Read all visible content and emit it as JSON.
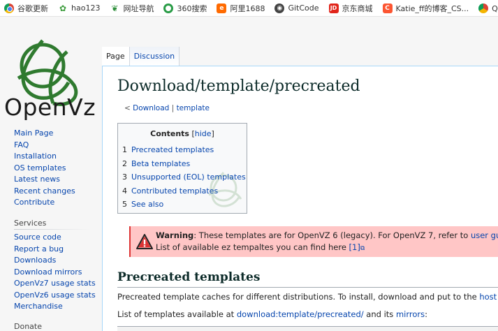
{
  "bookmarks": [
    {
      "label": "谷歌更新",
      "icon": "chrome-icon"
    },
    {
      "label": "hao123",
      "icon": "hao123-icon"
    },
    {
      "label": "网址导航",
      "icon": "nav-icon"
    },
    {
      "label": "360搜索",
      "icon": "360-search-icon"
    },
    {
      "label": "阿里1688",
      "icon": "alibaba-icon"
    },
    {
      "label": "GitCode",
      "icon": "gitcode-icon"
    },
    {
      "label": "京东商城",
      "icon": "jd-icon"
    },
    {
      "label": "Katie_ff的博客_CS...",
      "icon": "csdn-icon"
    },
    {
      "label": "QQ邮箱",
      "icon": "qq-mail-icon"
    }
  ],
  "logo_text": "OpenVz",
  "sidebar": {
    "nav": [
      "Main Page",
      "FAQ",
      "Installation",
      "OS templates",
      "Latest news",
      "Recent changes",
      "Contribute"
    ],
    "services_heading": "Services",
    "services": [
      "Source code",
      "Report a bug",
      "Downloads",
      "Download mirrors",
      "OpenVz7 usage stats",
      "OpenVz6 usage stats",
      "Merchandise"
    ],
    "donate_heading": "Donate"
  },
  "tabs": {
    "page": "Page",
    "discussion": "Discussion"
  },
  "page": {
    "title": "Download/template/precreated",
    "subpages_prefix": "< ",
    "subpage_download": "Download",
    "subpage_sep": " | ",
    "subpage_template": "template"
  },
  "toc": {
    "title": "Contents",
    "hide_open": " [",
    "hide": "hide",
    "hide_close": "]",
    "items": [
      {
        "num": "1",
        "label": "Precreated templates"
      },
      {
        "num": "2",
        "label": "Beta templates"
      },
      {
        "num": "3",
        "label": "Unsupported (EOL) templates"
      },
      {
        "num": "4",
        "label": "Contributed templates"
      },
      {
        "num": "5",
        "label": "See also"
      }
    ]
  },
  "warning": {
    "strong": "Warning",
    "text": ": These templates are for OpenVZ 6 (legacy). For OpenVZ 7, refer to ",
    "link": "user guid",
    "line2": "List of available ez tempaltes you can find here ",
    "ref": "[1]",
    "ext_icon": "external-link-icon"
  },
  "section": {
    "heading": "Precreated templates",
    "p1_text": "Precreated template caches for different distributions. To install, download and put to the ",
    "p1_link": "host s",
    "p2_prefix": "List of templates available at ",
    "p2_link1": "download:template/precreated/",
    "p2_mid": " and its ",
    "p2_link2": "mirrors",
    "p2_suffix": ":"
  },
  "colors": {
    "logo_green": "#2f7a2f",
    "link": "#0645ad",
    "warning_bg": "#ffc6c6",
    "warning_icon": "#d33"
  }
}
